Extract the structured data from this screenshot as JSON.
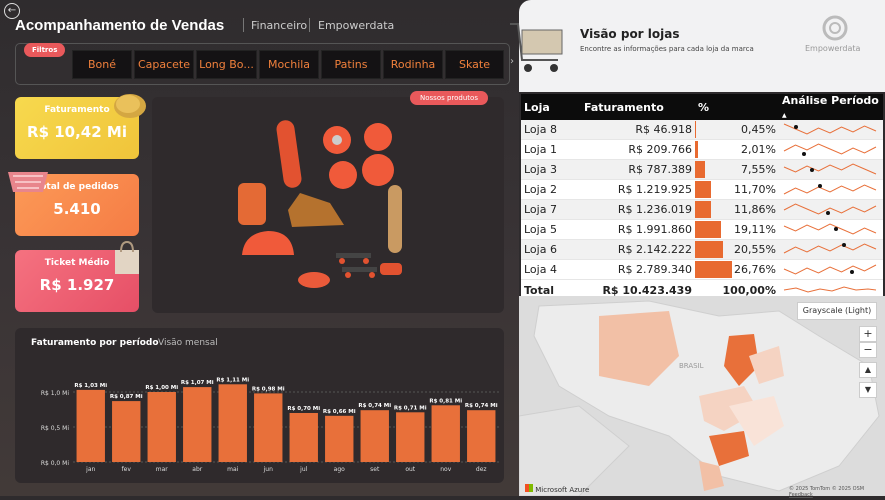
{
  "header": {
    "title": "Acompanhamento de Vendas",
    "nav1": "Financeiro",
    "nav2": "Empowerdata"
  },
  "filters": {
    "label": "Filtros",
    "items": [
      "Boné",
      "Capacete",
      "Long Bo...",
      "Mochila",
      "Patins",
      "Rodinha",
      "Skate"
    ]
  },
  "kpis": [
    {
      "label": "Faturamento",
      "value": "R$ 10,42 Mi"
    },
    {
      "label": "Total de pedidos",
      "value": "5.410"
    },
    {
      "label": "Ticket Médio",
      "value": "R$ 1.927"
    }
  ],
  "products": {
    "label": "Nossos produtos"
  },
  "chart_data": {
    "type": "bar",
    "title": "Faturamento por período",
    "subtitle": "Visão mensal",
    "categories": [
      "jan",
      "fev",
      "mar",
      "abr",
      "mai",
      "jun",
      "jul",
      "ago",
      "set",
      "out",
      "nov",
      "dez"
    ],
    "values": [
      1.03,
      0.87,
      1.0,
      1.07,
      1.11,
      0.98,
      0.7,
      0.66,
      0.74,
      0.71,
      0.81,
      0.74
    ],
    "labels": [
      "R$ 1,03 Mi",
      "R$ 0,87 Mi",
      "R$ 1,00 Mi",
      "R$ 1,07 Mi",
      "R$ 1,11 Mi",
      "R$ 0,98 Mi",
      "R$ 0,70 Mi",
      "R$ 0,66 Mi",
      "R$ 0,74 Mi",
      "R$ 0,71 Mi",
      "R$ 0,81 Mi",
      "R$ 0,74 Mi"
    ],
    "yticks": [
      "R$ 0,0 Mi",
      "R$ 0,5 Mi",
      "R$ 1,0 Mi"
    ],
    "ylim": [
      0,
      1.2
    ],
    "color": "#e8703a"
  },
  "stores": {
    "title": "Visão por lojas",
    "subtitle": "Encontre as informações para cada loja da marca",
    "brand": "Empowerdata",
    "columns": [
      "Loja",
      "Faturamento",
      "%",
      "Análise Período"
    ],
    "rows": [
      {
        "loja": "Loja 8",
        "fat": "R$ 46.918",
        "pct": "0,45%",
        "p": 0.45
      },
      {
        "loja": "Loja 1",
        "fat": "R$ 209.766",
        "pct": "2,01%",
        "p": 2.01
      },
      {
        "loja": "Loja 3",
        "fat": "R$ 787.389",
        "pct": "7,55%",
        "p": 7.55
      },
      {
        "loja": "Loja 2",
        "fat": "R$ 1.219.925",
        "pct": "11,70%",
        "p": 11.7
      },
      {
        "loja": "Loja 7",
        "fat": "R$ 1.236.019",
        "pct": "11,86%",
        "p": 11.86
      },
      {
        "loja": "Loja 5",
        "fat": "R$ 1.991.860",
        "pct": "19,11%",
        "p": 19.11
      },
      {
        "loja": "Loja 6",
        "fat": "R$ 2.142.222",
        "pct": "20,55%",
        "p": 20.55
      },
      {
        "loja": "Loja 4",
        "fat": "R$ 2.789.340",
        "pct": "26,76%",
        "p": 26.76
      }
    ],
    "total": {
      "label": "Total",
      "fat": "R$ 10.423.439",
      "pct": "100,00%"
    }
  },
  "map": {
    "style": "Grayscale (Light)",
    "label": "BRASIL",
    "provider": "Microsoft Azure",
    "attribution": "© 2025 TomTom © 2025 OSM",
    "feedback": "Feedback"
  }
}
